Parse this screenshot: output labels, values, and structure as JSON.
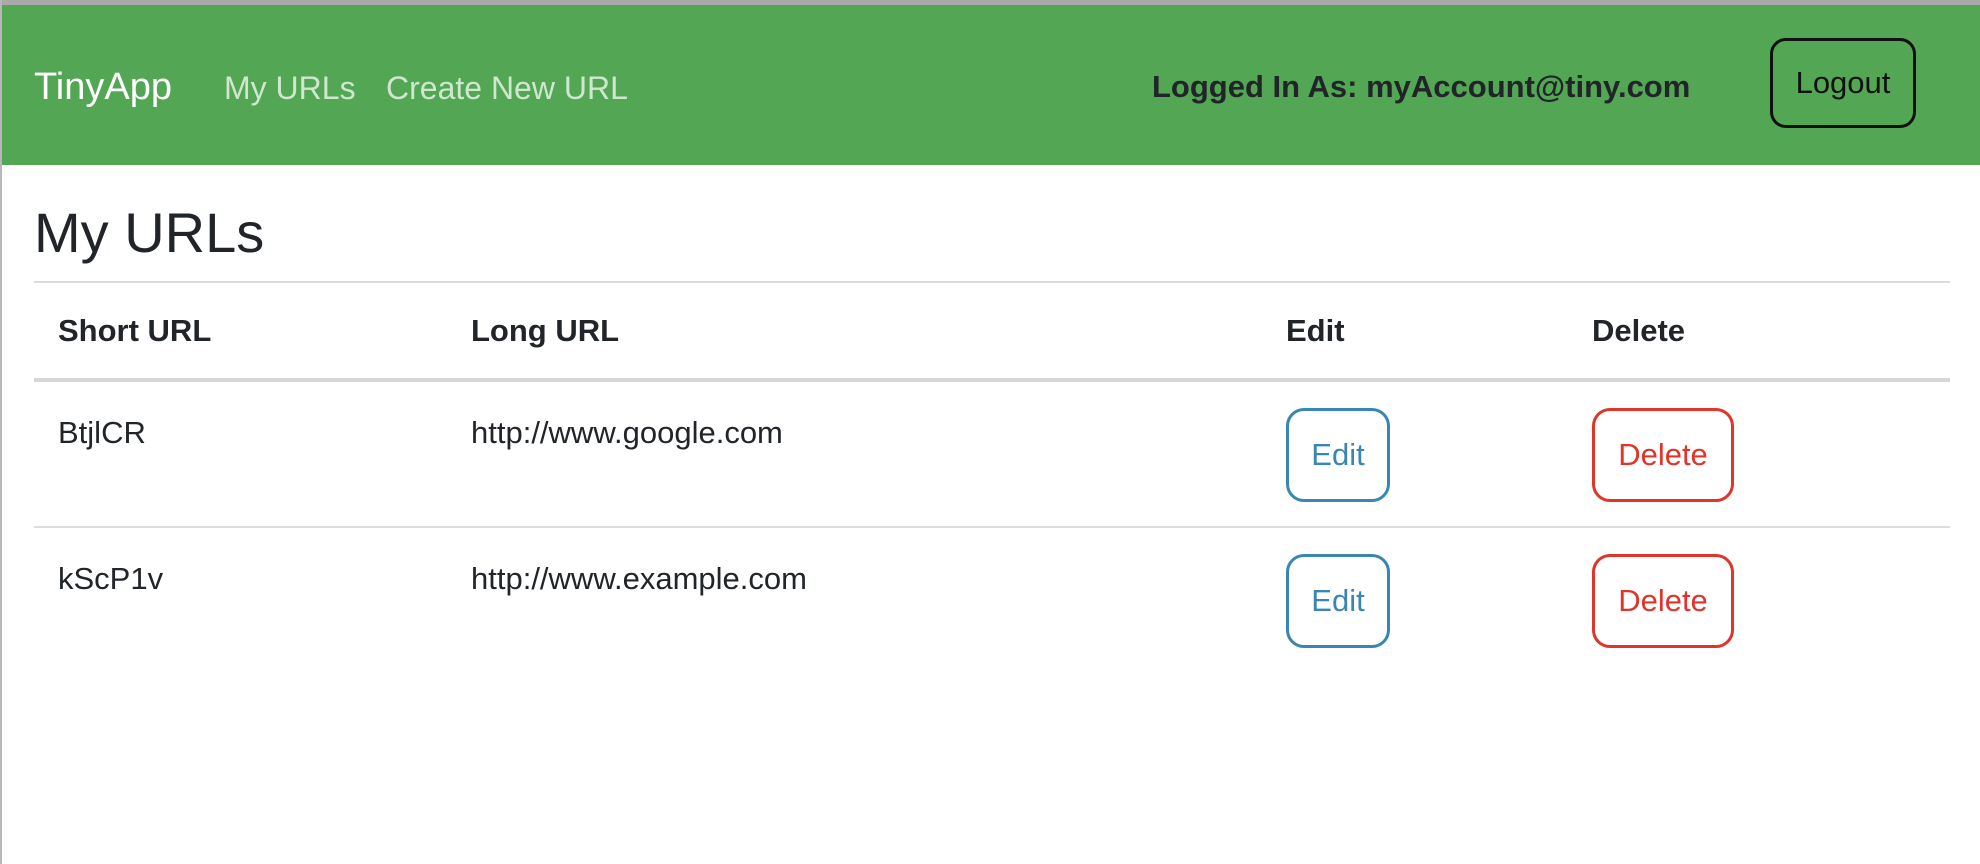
{
  "navbar": {
    "brand": "TinyApp",
    "links": [
      {
        "label": "My URLs"
      },
      {
        "label": "Create New URL"
      }
    ],
    "logged_in_text": "Logged In As: myAccount@tiny.com",
    "logout_label": "Logout",
    "background_color": "#53a653"
  },
  "main": {
    "title": "My URLs",
    "table": {
      "headers": [
        "Short URL",
        "Long URL",
        "Edit",
        "Delete"
      ],
      "rows": [
        {
          "short_url": "BtjlCR",
          "long_url": "http://www.google.com",
          "edit_label": "Edit",
          "delete_label": "Delete"
        },
        {
          "short_url": "kScP1v",
          "long_url": "http://www.example.com",
          "edit_label": "Edit",
          "delete_label": "Delete"
        }
      ]
    }
  },
  "colors": {
    "edit_button": "#3a86b3",
    "delete_button": "#e0352b"
  }
}
